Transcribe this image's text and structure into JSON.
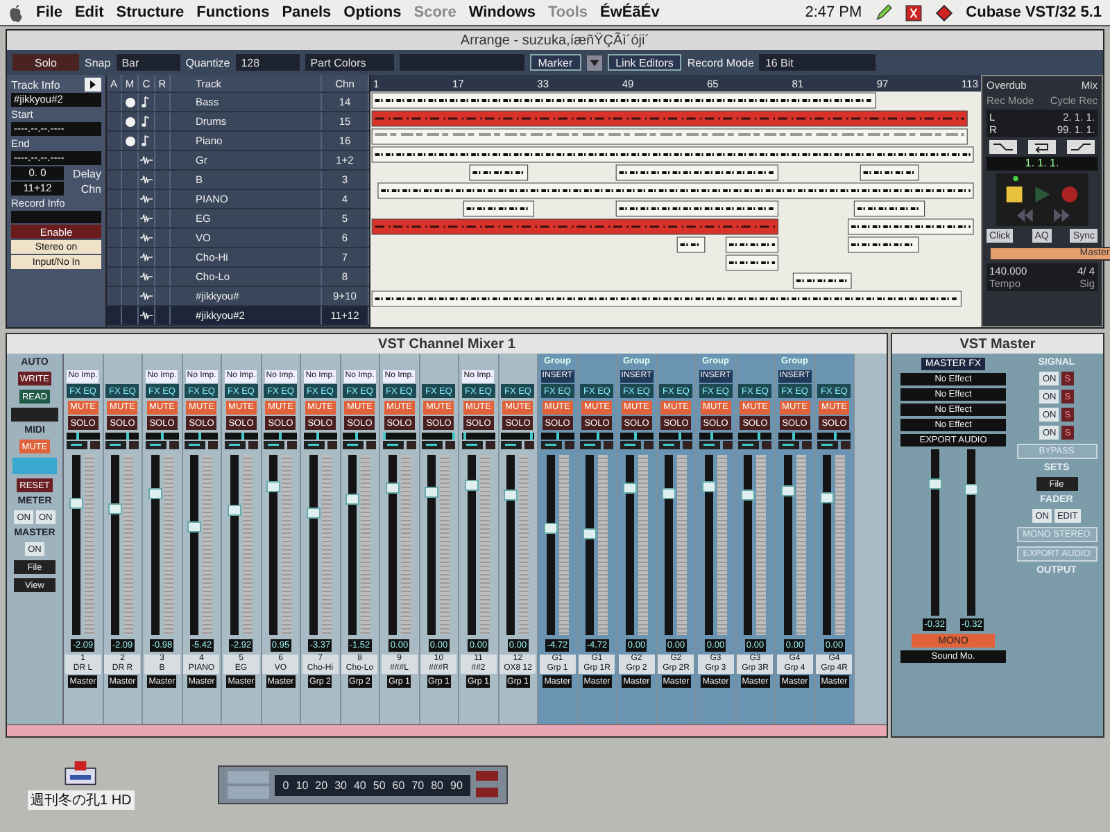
{
  "menubar": {
    "items": [
      {
        "label": "File",
        "disabled": false
      },
      {
        "label": "Edit",
        "disabled": false
      },
      {
        "label": "Structure",
        "disabled": false
      },
      {
        "label": "Functions",
        "disabled": false
      },
      {
        "label": "Panels",
        "disabled": false
      },
      {
        "label": "Options",
        "disabled": false
      },
      {
        "label": "Score",
        "disabled": true
      },
      {
        "label": "Windows",
        "disabled": false
      },
      {
        "label": "Tools",
        "disabled": true
      },
      {
        "label": "ÉwÉãÉv",
        "disabled": false
      }
    ],
    "clock": "2:47 PM",
    "app_name": "Cubase VST/32 5.1"
  },
  "arrange": {
    "title": "Arrange - suzuka,íæñŸÇÃì´óji´",
    "toolbar": {
      "solo": "Solo",
      "snap_label": "Snap",
      "snap": "Bar",
      "quantize_label": "Quantize",
      "quantize": "128",
      "part_colors": "Part Colors",
      "marker": "Marker",
      "link_editors": "Link Editors",
      "record_mode_label": "Record Mode",
      "record_mode": "16 Bit"
    },
    "track_info": {
      "title": "Track Info",
      "name": "#jikkyou#2",
      "start_label": "Start",
      "start": "----.--.--.----",
      "end_label": "End",
      "end": "----.--.--.----",
      "delay": "0. 0",
      "delay_label": "Delay",
      "channel": "11+12",
      "channel_label": "Chn",
      "record_info": "Record Info",
      "enable": "Enable",
      "stereo": "Stereo on",
      "input": "Input/No In"
    },
    "columns": [
      "A",
      "M",
      "C",
      "R",
      "Track",
      "Chn"
    ],
    "tracks": [
      {
        "name": "Bass",
        "chn": "14",
        "kind": "midi",
        "muted": true,
        "selected": false
      },
      {
        "name": "Drums",
        "chn": "15",
        "kind": "midi",
        "muted": true,
        "selected": false
      },
      {
        "name": "Piano",
        "chn": "16",
        "kind": "midi",
        "muted": true,
        "selected": false
      },
      {
        "name": "Gr",
        "chn": "1+2",
        "kind": "audio",
        "muted": false,
        "selected": false
      },
      {
        "name": "B",
        "chn": "3",
        "kind": "audio",
        "muted": false,
        "selected": false
      },
      {
        "name": "PIANO",
        "chn": "4",
        "kind": "audio",
        "muted": false,
        "selected": false
      },
      {
        "name": "EG",
        "chn": "5",
        "kind": "audio",
        "muted": false,
        "selected": false
      },
      {
        "name": "VO",
        "chn": "6",
        "kind": "audio",
        "muted": false,
        "selected": false
      },
      {
        "name": "Cho-Hi",
        "chn": "7",
        "kind": "audio",
        "muted": false,
        "selected": false
      },
      {
        "name": "Cho-Lo",
        "chn": "8",
        "kind": "audio",
        "muted": false,
        "selected": false
      },
      {
        "name": "#jikkyou#",
        "chn": "9+10",
        "kind": "audio",
        "muted": false,
        "selected": false
      },
      {
        "name": "#jikkyou#2",
        "chn": "11+12",
        "kind": "audio",
        "muted": false,
        "selected": true
      }
    ],
    "ruler": [
      "1",
      "17",
      "33",
      "49",
      "65",
      "81",
      "97",
      "113"
    ],
    "transport": {
      "overdub": "Overdub",
      "mix": "Mix",
      "rec_mode": "Rec Mode",
      "cycle_rec": "Cycle Rec",
      "left_label": "L",
      "left": "2. 1. 1.",
      "right_label": "R",
      "right": "99. 1. 1.",
      "position": "1. 1. 1.",
      "click": "Click",
      "aq": "AQ",
      "sync": "Sync",
      "master": "Master",
      "tempo": "140.000",
      "signature": "4/ 4",
      "tempo_label": "Tempo",
      "signature_label": "Sig"
    }
  },
  "mixer": {
    "title": "VST Channel Mixer 1",
    "left_panel": {
      "auto": "AUTO",
      "write": "WRITE",
      "read": "READ",
      "midi": "MIDI",
      "midi_mute": "MUTE",
      "reset": "RESET",
      "meter": "METER",
      "meter_on": [
        "ON",
        "ON"
      ],
      "master": "MASTER",
      "master_on": "ON",
      "file": "File",
      "view": "View"
    },
    "channels": [
      {
        "kind": "audio",
        "number": "1",
        "name": "DR L",
        "output": "Master",
        "value": "-2.09",
        "level": 0.73,
        "pan": {
          "level": 0.35
        },
        "insert": "No Imp.",
        "fx_eq": "FX EQ",
        "mute": "MUTE",
        "solo": "SOLO"
      },
      {
        "kind": "audio",
        "number": "2",
        "name": "DR R",
        "output": "Master",
        "value": "-2.09",
        "level": 0.7,
        "pan": {
          "level": 0.65
        },
        "fx_eq": "FX EQ",
        "mute": "MUTE",
        "solo": "SOLO"
      },
      {
        "kind": "audio",
        "number": "3",
        "name": "B",
        "output": "Master",
        "value": "-0.98",
        "level": 0.78,
        "pan": {
          "level": 0.5
        },
        "insert": "No Imp.",
        "fx_eq": "FX EQ",
        "mute": "MUTE",
        "solo": "SOLO"
      },
      {
        "kind": "audio",
        "number": "4",
        "name": "PIANO",
        "output": "Master",
        "value": "-5.42",
        "level": 0.6,
        "pan": {
          "level": 0.45
        },
        "insert": "No Imp.",
        "fx_eq": "FX EQ",
        "mute": "MUTE",
        "solo": "SOLO"
      },
      {
        "kind": "audio",
        "number": "5",
        "name": "EG",
        "output": "Master",
        "value": "-2.92",
        "level": 0.69,
        "pan": {
          "level": 0.55
        },
        "insert": "No Imp.",
        "fx_eq": "FX EQ",
        "mute": "MUTE",
        "solo": "SOLO"
      },
      {
        "kind": "audio",
        "number": "6",
        "name": "VO",
        "output": "Master",
        "value": "0.95",
        "level": 0.82,
        "pan": {
          "level": 0.5
        },
        "insert": "No Imp.",
        "fx_eq": "FX EQ",
        "mute": "MUTE",
        "solo": "SOLO"
      },
      {
        "kind": "audio",
        "number": "7",
        "name": "Cho-Hi",
        "output": "Grp 2",
        "value": "-3.37",
        "level": 0.67,
        "pan": {
          "level": 0.42
        },
        "insert": "No Imp.",
        "fx_eq": "FX EQ",
        "mute": "MUTE",
        "solo": "SOLO"
      },
      {
        "kind": "audio",
        "number": "8",
        "name": "Cho-Lo",
        "output": "Grp 2",
        "value": "-1.52",
        "level": 0.75,
        "pan": {
          "level": 0.4
        },
        "insert": "No Imp.",
        "fx_eq": "FX EQ",
        "mute": "MUTE",
        "solo": "SOLO"
      },
      {
        "kind": "audio",
        "number": "9",
        "name": "###L",
        "output": "Grp 1",
        "value": "0.00",
        "level": 0.81,
        "pan": {
          "level": 0.05
        },
        "insert": "No Imp.",
        "fx_eq": "FX EQ",
        "mute": "MUTE",
        "solo": "SOLO"
      },
      {
        "kind": "audio",
        "number": "10",
        "name": "###R",
        "output": "Grp 1",
        "value": "0.00",
        "level": 0.79,
        "pan": {
          "level": 0.95
        },
        "fx_eq": "FX EQ",
        "mute": "MUTE",
        "solo": "SOLO"
      },
      {
        "kind": "audio",
        "number": "11",
        "name": "##2",
        "output": "Grp 1",
        "value": "0.00",
        "level": 0.83,
        "pan": {
          "level": 0.1
        },
        "insert": "No Imp.",
        "fx_eq": "FX EQ",
        "mute": "MUTE",
        "solo": "SOLO"
      },
      {
        "kind": "audio",
        "number": "12",
        "name": "OX8 12",
        "output": "Grp 1",
        "value": "0.00",
        "level": 0.77,
        "pan": {
          "level": 0.9
        },
        "fx_eq": "FX EQ",
        "mute": "MUTE",
        "solo": "SOLO"
      },
      {
        "kind": "group",
        "number": "G1",
        "name": "Grp 1",
        "output": "Master",
        "value": "-4.72",
        "level": 0.59,
        "pan": {
          "level": 0.5
        },
        "insert": "INSERT",
        "header": "Group",
        "fx_eq": "FX EQ",
        "mute": "MUTE",
        "solo": "SOLO"
      },
      {
        "kind": "group",
        "number": "G1",
        "name": "Grp 1R",
        "output": "Master",
        "value": "-4.72",
        "level": 0.56,
        "pan": {
          "level": 0.55
        },
        "fx_eq": "FX EQ",
        "mute": "MUTE",
        "solo": "SOLO"
      },
      {
        "kind": "group",
        "number": "G2",
        "name": "Grp 2",
        "output": "Master",
        "value": "0.00",
        "level": 0.81,
        "pan": {
          "level": 0.45
        },
        "insert": "INSERT",
        "header": "Group",
        "fx_eq": "FX EQ",
        "mute": "MUTE",
        "solo": "SOLO"
      },
      {
        "kind": "group",
        "number": "G2",
        "name": "Grp 2R",
        "output": "Master",
        "value": "0.00",
        "level": 0.78,
        "pan": {
          "level": 0.6
        },
        "fx_eq": "FX EQ",
        "mute": "MUTE",
        "solo": "SOLO"
      },
      {
        "kind": "group",
        "number": "G3",
        "name": "Grp 3",
        "output": "Master",
        "value": "0.00",
        "level": 0.82,
        "pan": {
          "level": 0.4
        },
        "insert": "INSERT",
        "header": "Group",
        "fx_eq": "FX EQ",
        "mute": "MUTE",
        "solo": "SOLO"
      },
      {
        "kind": "group",
        "number": "G3",
        "name": "Grp 3R",
        "output": "Master",
        "value": "0.00",
        "level": 0.77,
        "pan": {
          "level": 0.6
        },
        "fx_eq": "FX EQ",
        "mute": "MUTE",
        "solo": "SOLO"
      },
      {
        "kind": "group",
        "number": "G4",
        "name": "Grp 4",
        "output": "Master",
        "value": "0.00",
        "level": 0.8,
        "pan": {
          "level": 0.45
        },
        "insert": "INSERT",
        "header": "Group",
        "fx_eq": "FX EQ",
        "mute": "MUTE",
        "solo": "SOLO"
      },
      {
        "kind": "group",
        "number": "G4",
        "name": "Grp 4R",
        "output": "Master",
        "value": "0.00",
        "level": 0.76,
        "pan": {
          "level": 0.55
        },
        "fx_eq": "FX EQ",
        "mute": "MUTE",
        "solo": "SOLO"
      }
    ]
  },
  "master": {
    "title": "VST Master",
    "master_fx": "MASTER FX",
    "effects": [
      "No Effect",
      "No Effect",
      "No Effect",
      "No Effect"
    ],
    "signal": "SIGNAL",
    "signal_rows": [
      {
        "on": "ON",
        "s": "S"
      },
      {
        "on": "ON",
        "s": "S"
      },
      {
        "on": "ON",
        "s": "S"
      },
      {
        "on": "ON",
        "s": "S"
      }
    ],
    "export_audio": "EXPORT AUDIO",
    "bypass": "BYPASS",
    "sets": "SETS",
    "file": "File",
    "fader": "FADER",
    "on": "ON",
    "edit": "EDIT",
    "mono_stereo": "MONO STEREO",
    "export_audio_2": "EXPORT AUDIO",
    "output": "OUTPUT",
    "faders": [
      {
        "value": "-0.32",
        "level": 0.79
      },
      {
        "value": "-0.32",
        "level": 0.76
      }
    ],
    "mono": "MONO",
    "sound_mode": "Sound Mo."
  },
  "desktop": {
    "disk_label": "週刊冬の孔1 HD",
    "scale": [
      "0",
      "10",
      "20",
      "30",
      "40",
      "50",
      "60",
      "70",
      "80",
      "90"
    ]
  }
}
